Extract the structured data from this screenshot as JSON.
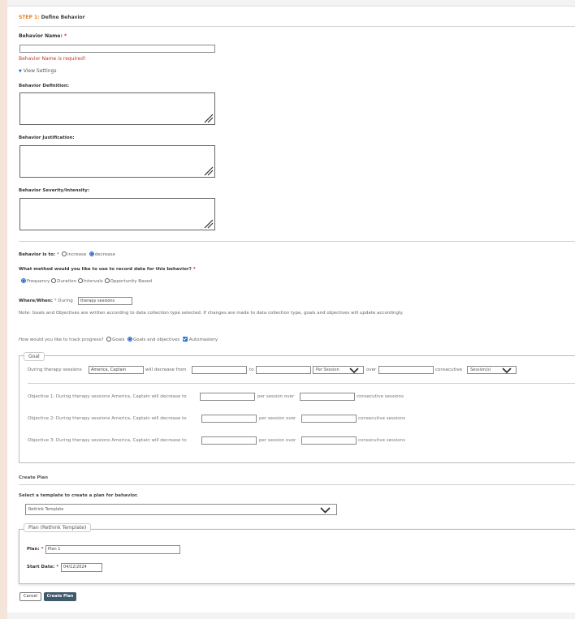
{
  "step": {
    "prefix": "STEP 1:",
    "title": "Define Behavior"
  },
  "behavior_name": {
    "label": "Behavior Name:",
    "required": "*",
    "error": "Behavior Name is required!"
  },
  "view_settings": {
    "label": "View Settings"
  },
  "definition": {
    "label": "Behavior Definition:"
  },
  "justification": {
    "label": "Behavior Justification:"
  },
  "severity": {
    "label": "Behavior Severity/Intensity:"
  },
  "behavior_is_to": {
    "label": "Behavior is to:",
    "required": "*",
    "options": [
      "increase",
      "decrease"
    ],
    "selected": "decrease"
  },
  "method": {
    "label": "What method would you like to use to record data for this behavior?",
    "required": "*",
    "options": [
      "Frequency",
      "Duration",
      "Intervals",
      "Opportunity Based"
    ],
    "selected": "Frequency"
  },
  "where_when": {
    "label": "Where/When:",
    "required": "*",
    "prefix": "During",
    "value": "therapy sessions"
  },
  "note": "Note: Goals and Objectives are written according to data collection type selected. If changes are made to data collection type, goals and objectives will update accordingly.",
  "track": {
    "label": "How would you like to track progress?",
    "options": [
      "Goals",
      "Goals and objectives"
    ],
    "selected": "Goals and objectives",
    "automastery_label": "Automastery",
    "automastery_checked": true
  },
  "goal": {
    "legend": "Goal",
    "prefix": "During therapy sessions",
    "client": "America, Captain",
    "decrease_from": "will decrease from",
    "to": "to",
    "per_select": "Per Session",
    "over": "over",
    "consecutive": "consecutive",
    "sessions_select": "Session(s)"
  },
  "objectives": [
    {
      "text": "Objective 1: During therapy sessions America, Captain will decrease to",
      "per": "per session over",
      "tail": "consecutive sessions"
    },
    {
      "text": "Objective 2: During therapy sessions America, Captain will decrease to",
      "per": "per session over",
      "tail": "consecutive sessions"
    },
    {
      "text": "Objective 3: During therapy sessions America, Captain will decrease to",
      "per": "per session over",
      "tail": "consecutive sessions"
    }
  ],
  "create_plan": {
    "title": "Create Plan",
    "template_label": "Select a template to create a plan for behavior.",
    "template_value": "Rethink Template"
  },
  "plan": {
    "legend": "Plan (Rethink Template)",
    "plan_label": "Plan:",
    "plan_required": "*",
    "plan_value": "Plan 1",
    "start_label": "Start Date:",
    "start_required": "*",
    "start_value": "04/12/2024"
  },
  "buttons": {
    "cancel": "Cancel",
    "create": "Create Plan"
  },
  "colors": {
    "accent_bar": "#f4e4da",
    "step_orange": "#e67e22",
    "error_red": "#c0392b",
    "primary_button": "#3f5a6b",
    "radio_blue": "#2d6cc7"
  }
}
